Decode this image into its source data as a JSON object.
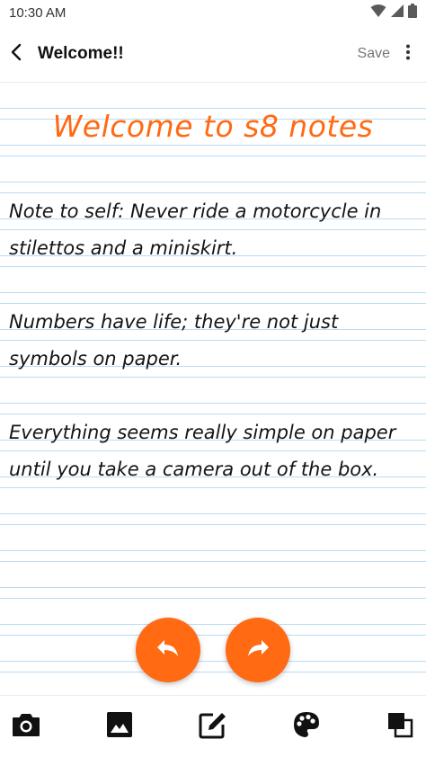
{
  "status_bar": {
    "time": "10:30 AM"
  },
  "app_bar": {
    "title": "Welcome!!",
    "save_label": "Save"
  },
  "note": {
    "title": "Welcome to s8 notes",
    "lines": [
      "Note to self: Never ride a motorcycle in",
      "stilettos and a miniskirt.",
      "",
      "Numbers have life; they're not just",
      "symbols on paper.",
      "",
      "Everything seems really simple on paper",
      "until you take a camera out of the box."
    ]
  },
  "icons": {
    "back": "arrow-left-icon",
    "more": "more-vert-icon",
    "undo": "undo-icon",
    "redo": "redo-icon",
    "camera": "camera-icon",
    "image": "image-icon",
    "edit": "edit-icon",
    "palette": "palette-icon",
    "layers": "layers-icon"
  },
  "colors": {
    "accent": "#ff6a13",
    "rule_line": "#bcdcf1",
    "text": "#141414"
  }
}
